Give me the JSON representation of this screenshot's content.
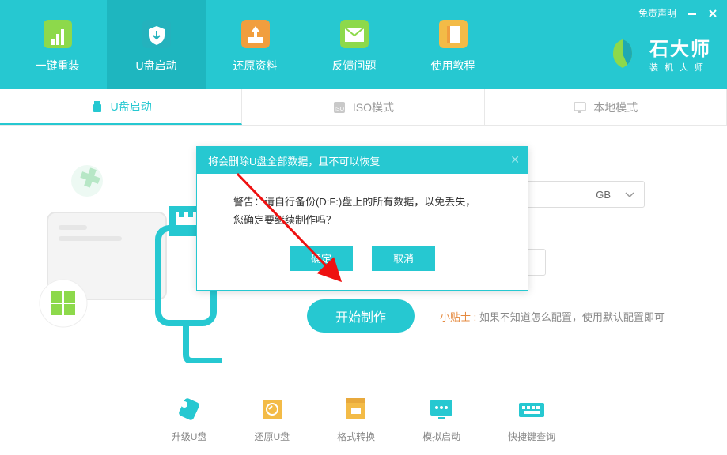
{
  "header": {
    "nav": {
      "oneKey": "一键重装",
      "usb": "U盘启动",
      "restore": "还原资料",
      "feedback": "反馈问题",
      "tutorial": "使用教程"
    },
    "disclaimer": "免责声明",
    "brand": {
      "main": "石大师",
      "sub": "装机大师"
    }
  },
  "subtabs": {
    "usb": "U盘启动",
    "iso": "ISO模式",
    "local": "本地模式"
  },
  "main": {
    "dropdownSuffix": "GB",
    "startBtn": "开始制作",
    "tipLabel": "小贴士 :",
    "tipText": "如果不知道怎么配置，使用默认配置即可"
  },
  "tools": {
    "upgrade": "升级U盘",
    "restore": "还原U盘",
    "format": "格式转换",
    "simulate": "模拟启动",
    "shortcuts": "快捷键查询"
  },
  "modal": {
    "title": "将会删除U盘全部数据，且不可以恢复",
    "line1": "警告：请自行备份(D:F:)盘上的所有数据，以免丢失，",
    "line2": "您确定要继续制作吗？",
    "ok": "确定",
    "cancel": "取消"
  }
}
